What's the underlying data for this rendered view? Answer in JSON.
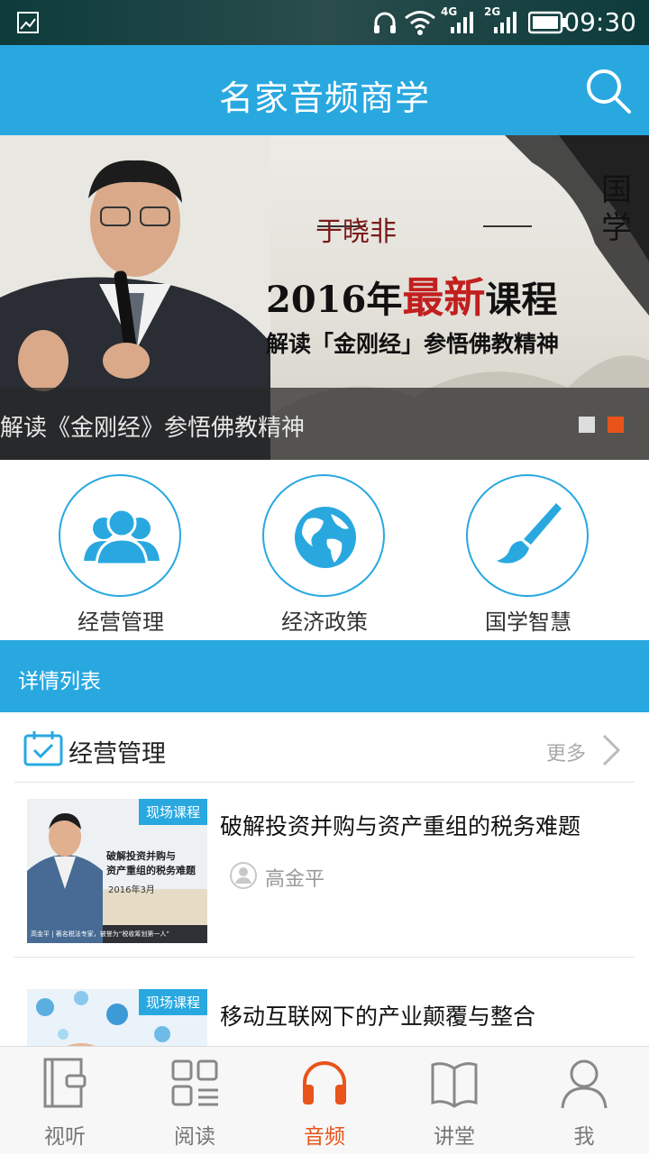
{
  "status_bar": {
    "time": "09:30",
    "network_1": "4G",
    "network_2": "2G"
  },
  "app_bar": {
    "title": "名家音频商学",
    "search_icon": "search-icon"
  },
  "banner": {
    "author": "于晓非",
    "headline_year": "2016",
    "headline_a": "年",
    "headline_highlight": "最新",
    "headline_b": "课程",
    "subtitle": "解读「金刚经」参悟佛教精神",
    "seal_1": "国",
    "seal_2": "学",
    "caption": "解读《金刚经》参悟佛教精神",
    "page_count": 2,
    "active_index": 2,
    "dot_active_color": "#e8541b",
    "dot_inactive_color": "#dddddd"
  },
  "categories": [
    {
      "label": "经营管理",
      "icon": "group-icon"
    },
    {
      "label": "经济政策",
      "icon": "globe-icon"
    },
    {
      "label": "国学智慧",
      "icon": "brush-icon"
    }
  ],
  "section": {
    "title": "详情列表"
  },
  "list_section": {
    "name": "经营管理",
    "more_label": "更多",
    "items": [
      {
        "tag": "现场课程",
        "title": "破解投资并购与资产重组的税务难题",
        "speaker": "高金平",
        "thumb_title_1": "破解投资并购与",
        "thumb_title_2": "资产重组的税务难题",
        "thumb_date": "2016年3月",
        "thumb_caption": "高金平 | 著名税法专家，被誉为“税收筹划第一人”"
      },
      {
        "tag": "现场课程",
        "title": "移动互联网下的产业颠覆与整合",
        "speaker": ""
      }
    ]
  },
  "tabs": [
    {
      "label": "视听",
      "icon": "notebook-icon",
      "active": false
    },
    {
      "label": "阅读",
      "icon": "grid-icon",
      "active": false
    },
    {
      "label": "音频",
      "icon": "headphones-icon",
      "active": true
    },
    {
      "label": "讲堂",
      "icon": "book-icon",
      "active": false
    },
    {
      "label": "我",
      "icon": "person-icon",
      "active": false
    }
  ],
  "colors": {
    "accent": "#29a8e0",
    "active_tab": "#e8541b",
    "inactive_tab": "#777777"
  }
}
